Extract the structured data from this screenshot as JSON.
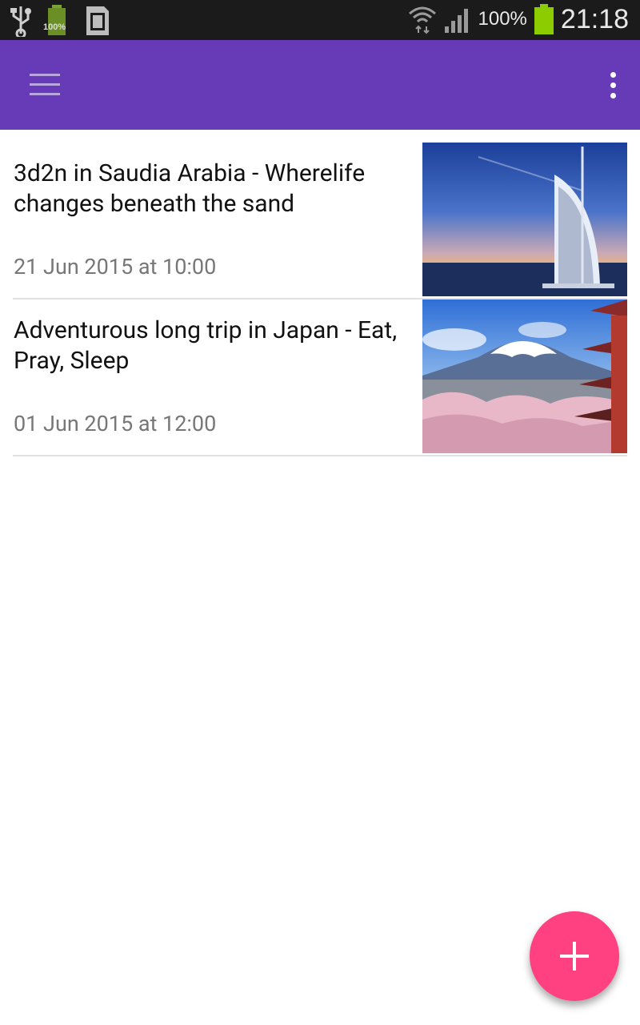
{
  "status_bar": {
    "battery_small_label": "100%",
    "battery_percent": "100%",
    "time": "21:18"
  },
  "app_bar": {
    "menu_icon": "hamburger-menu-icon",
    "overflow_icon": "more-vert-icon",
    "color": "#673ab7"
  },
  "trips": [
    {
      "title": "3d2n in Saudia Arabia - Wherelife changes beneath the sand",
      "date": "21 Jun 2015 at 10:00",
      "image": "burj-al-arab-photo"
    },
    {
      "title": "Adventurous long trip in Japan - Eat, Pray, Sleep",
      "date": "01 Jun 2015 at 12:00",
      "image": "mount-fuji-cherry-blossom-photo"
    }
  ],
  "fab": {
    "icon": "plus-icon",
    "color": "#ff4081"
  }
}
